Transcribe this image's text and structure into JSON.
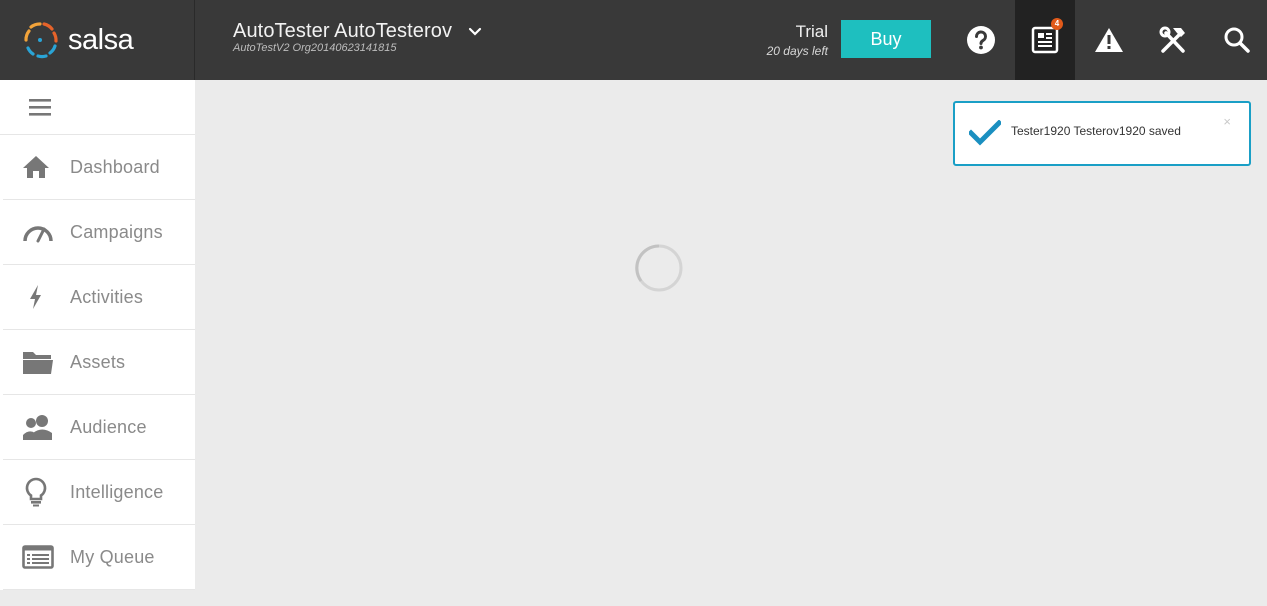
{
  "brand": {
    "name": "salsa"
  },
  "account": {
    "name": "AutoTester AutoTesterov",
    "org": "AutoTestV2 Org20140623141815"
  },
  "trial": {
    "label": "Trial",
    "days_left": "20 days left",
    "buy_label": "Buy"
  },
  "toolbar": {
    "icons": [
      "help-icon",
      "news-icon",
      "alert-icon",
      "tools-icon",
      "search-icon"
    ],
    "news_badge": "4",
    "accent": "#1ebfbf"
  },
  "sidebar": {
    "items": [
      {
        "label": "Dashboard",
        "icon": "home-icon"
      },
      {
        "label": "Campaigns",
        "icon": "gauge-icon"
      },
      {
        "label": "Activities",
        "icon": "lightning-icon"
      },
      {
        "label": "Assets",
        "icon": "folder-icon"
      },
      {
        "label": "Audience",
        "icon": "people-icon"
      },
      {
        "label": "Intelligence",
        "icon": "lightbulb-icon"
      },
      {
        "label": "My Queue",
        "icon": "queue-icon"
      }
    ]
  },
  "toast": {
    "message": "Tester1920 Testerov1920 saved",
    "close": "×",
    "color": "#1a9fc6"
  }
}
